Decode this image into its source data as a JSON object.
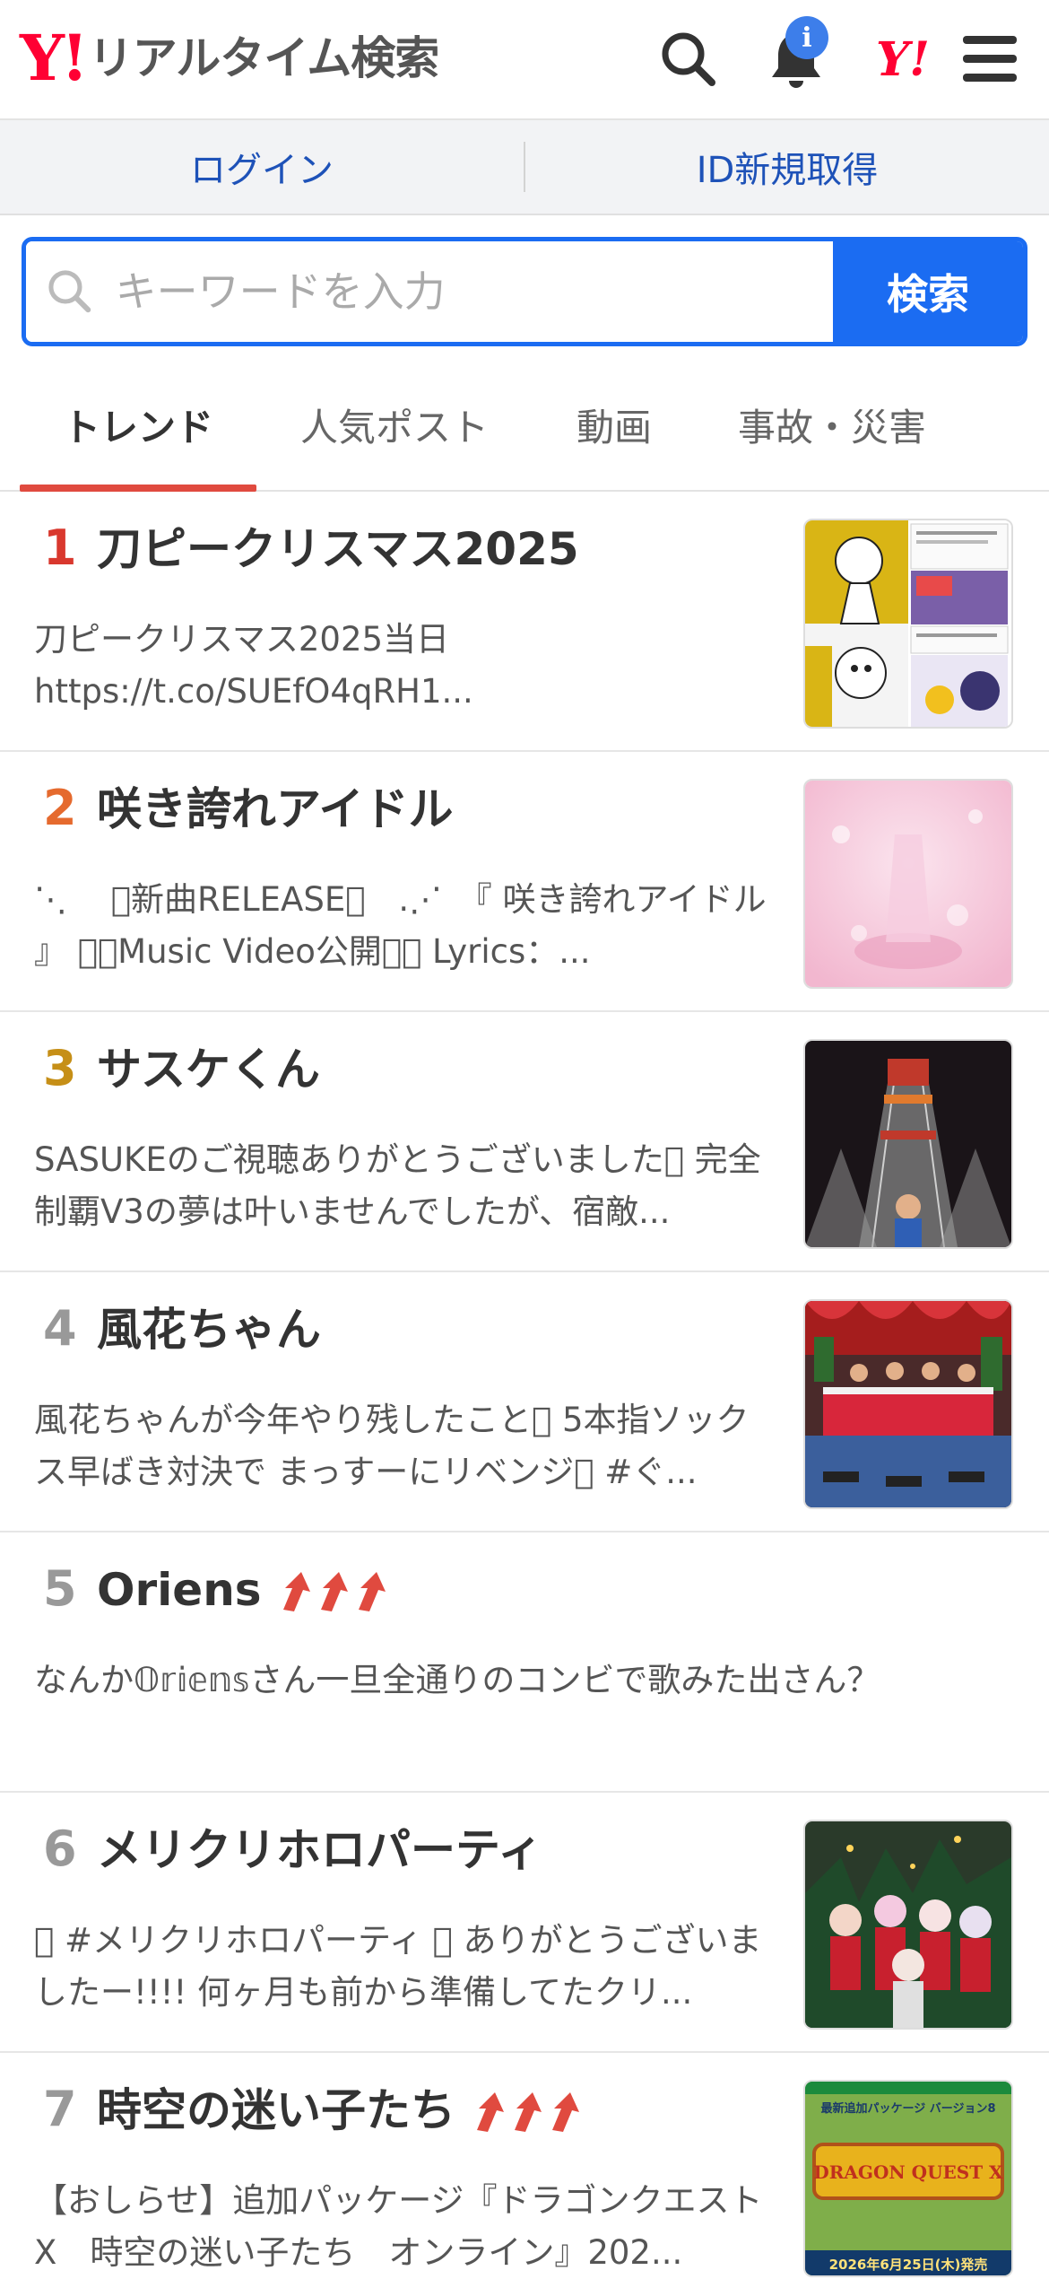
{
  "header": {
    "logo_mark": "Y!",
    "logo_text": "リアルタイム検索",
    "notification_count": "i",
    "yahoo_mark": "Y!"
  },
  "account": {
    "login": "ログイン",
    "signup": "ID新規取得"
  },
  "search": {
    "placeholder": "キーワードを入力",
    "button": "検索"
  },
  "tabs": [
    {
      "label": "トレンド",
      "active": true
    },
    {
      "label": "人気ポスト",
      "active": false
    },
    {
      "label": "動画",
      "active": false
    },
    {
      "label": "事故・災害",
      "active": false
    }
  ],
  "colors": {
    "accent": "#1b6cf2",
    "brand_red": "#ff0033",
    "rank1": "#d9382e",
    "rank2": "#e56a2e",
    "rank3": "#c68f17",
    "rank_other": "#999999",
    "rising_arrow": "#e04a3f"
  },
  "trends": [
    {
      "rank": "1",
      "title": "刀ピークリスマス2025",
      "desc": "刀ピークリスマス2025当日 https://t.co/SUEfO4qRH1...",
      "rising": false,
      "thumb": "manga-panels"
    },
    {
      "rank": "2",
      "title": "咲き誇れアイドル",
      "desc": "⋱ 　􏰀新曲RELEASE􏰀　.⋰　『 咲き誇れアイドル 』 􏰀􏰀Music Video公開􏰀􏰀 Lyrics：...",
      "rising": false,
      "thumb": "pink-stage"
    },
    {
      "rank": "3",
      "title": "サスケくん",
      "desc": "SASUKEのご視聴ありがとうございました􏰀 完全制覇V3の夢は叶いませんでしたが、宿敵...",
      "rising": false,
      "thumb": "tower-night"
    },
    {
      "rank": "4",
      "title": "風花ちゃん",
      "desc": "風花ちゃんが今年やり残したこと􏰀 5本指ソックス早ばき対決で まっすーにリベンジ􏰀 #ぐ...",
      "rising": false,
      "thumb": "studio-xmas"
    },
    {
      "rank": "5",
      "title": "Oriens",
      "desc": "なんか𝕆𝕣𝕚𝕖𝕟𝕤さん一旦全通りのコンビで歌みた出さん？",
      "rising": true,
      "thumb": ""
    },
    {
      "rank": "6",
      "title": "メリクリホロパーティ",
      "desc": "􏰀 #メリクリホロパーティ 􏰀 ありがとうございましたー!!!! 何ヶ月も前から準備してたクリ...",
      "rising": false,
      "thumb": "santa-group"
    },
    {
      "rank": "7",
      "title": "時空の迷い子たち",
      "desc": "【おしらせ】追加パッケージ『ドラゴンクエストX　時空の迷い子たち　オンライン』202...",
      "rising": true,
      "thumb": "game-package"
    }
  ],
  "game_package": {
    "top_label": "最新追加パッケージ バージョン8",
    "logo": "DRAGON QUEST X",
    "bottom_label": "2026年6月25日(木)発売"
  }
}
